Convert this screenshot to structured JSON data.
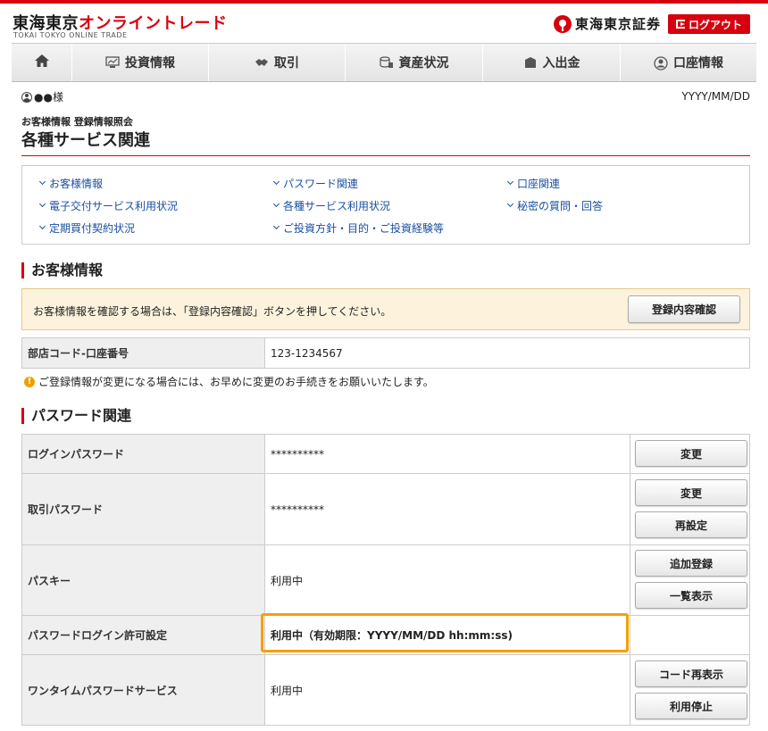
{
  "header": {
    "logo_part1": "東海東京",
    "logo_part2": "オンライントレード",
    "logo_en": "TOKAI TOKYO ONLINE TRADE",
    "brand": "東海東京証券",
    "logout_label": "ログアウト",
    "accent_color": "#d7000f"
  },
  "nav": {
    "items": [
      {
        "label": "",
        "icon": "home-icon"
      },
      {
        "label": "投資情報",
        "icon": "chart-monitor-icon"
      },
      {
        "label": "取引",
        "icon": "handshake-icon"
      },
      {
        "label": "資産状況",
        "icon": "coins-icon"
      },
      {
        "label": "入出金",
        "icon": "wallet-icon"
      },
      {
        "label": "口座情報",
        "icon": "user-circle-icon"
      }
    ]
  },
  "user": {
    "name": "●●様",
    "date": "YYYY/MM/DD"
  },
  "page": {
    "breadcrumb": "お客様情報 登録情報照会",
    "title": "各種サービス関連"
  },
  "links": [
    "お客様情報",
    "パスワード関連",
    "口座関連",
    "電子交付サービス利用状況",
    "各種サービス利用状況",
    "秘密の質問・回答",
    "定期買付契約状況",
    "ご投資方針・目的・ご投資経験等"
  ],
  "customer_section": {
    "heading": "お客様情報",
    "notice_text": "お客様情報を確認する場合は、「登録内容確認」ボタンを押してください。",
    "confirm_button": "登録内容確認",
    "account_label": "部店コード-口座番号",
    "account_value": "123-1234567",
    "warning": "ご登録情報が変更になる場合には、お早めに変更のお手続きをお願いいたします。"
  },
  "password_section": {
    "heading": "パスワード関連",
    "rows": [
      {
        "label": "ログインパスワード",
        "value": "**********",
        "buttons": [
          "変更"
        ]
      },
      {
        "label": "取引パスワード",
        "value": "**********",
        "buttons": [
          "変更",
          "再設定"
        ]
      },
      {
        "label": "パスキー",
        "value": "利用中",
        "buttons": [
          "追加登録",
          "一覧表示"
        ]
      },
      {
        "label": "パスワードログイン許可設定",
        "value": "利用中（有効期限：YYYY/MM/DD hh:mm:ss)",
        "buttons": []
      },
      {
        "label": "ワンタイムパスワードサービス",
        "value": "利用中",
        "buttons": [
          "コード再表示",
          "利用停止"
        ]
      }
    ]
  }
}
